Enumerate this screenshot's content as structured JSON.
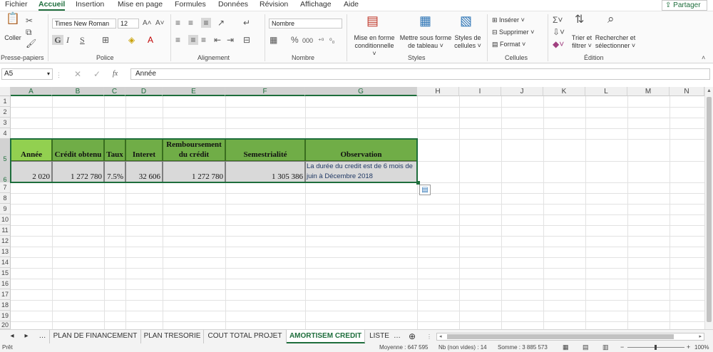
{
  "menu": {
    "items": [
      "Fichier",
      "Accueil",
      "Insertion",
      "Mise en page",
      "Formules",
      "Données",
      "Révision",
      "Affichage",
      "Aide"
    ],
    "share": "Partager"
  },
  "ribbon": {
    "clipboard": {
      "paste": "Coller",
      "label": "Presse-papiers"
    },
    "font": {
      "name": "Times New Roman",
      "size": "12",
      "bold": "G",
      "italic": "I",
      "underline": "S",
      "label": "Police"
    },
    "alignment": {
      "label": "Alignement"
    },
    "number": {
      "format": "Nombre",
      "percent": "%",
      "thousands": "000",
      "label": "Nombre"
    },
    "styles": {
      "conditional": [
        "Mise en forme",
        "conditionnelle"
      ],
      "table": [
        "Mettre sous forme",
        "de tableau"
      ],
      "cell_styles": [
        "Styles de",
        "cellules"
      ],
      "label": "Styles"
    },
    "cells": {
      "insert": "Insérer",
      "delete": "Supprimer",
      "format": "Format",
      "label": "Cellules"
    },
    "editing": {
      "sort": [
        "Trier et",
        "filtrer"
      ],
      "find": [
        "Rechercher et",
        "sélectionner"
      ],
      "label": "Édition"
    }
  },
  "formula_bar": {
    "name_box": "A5",
    "fx": "fx",
    "value": "Année"
  },
  "columns": [
    "A",
    "B",
    "C",
    "D",
    "E",
    "F",
    "G",
    "H",
    "I",
    "J",
    "K",
    "L",
    "M",
    "N"
  ],
  "rows": [
    "1",
    "2",
    "3",
    "4",
    "5",
    "6",
    "7",
    "8",
    "9",
    "10",
    "11",
    "12",
    "13",
    "14",
    "15",
    "16",
    "17",
    "18",
    "19",
    "20"
  ],
  "table": {
    "headers": [
      "Année",
      "Crédit obtenu",
      "Taux",
      "Interet",
      "Remboursement du crédit",
      "Semestrialité",
      "Observation"
    ],
    "values": [
      "2 020",
      "1 272 780",
      "7.5%",
      "32 606",
      "1 272 780",
      "1 305 386"
    ],
    "observation": "La durée du credit est de 6 mois de juin à Décembre 2018"
  },
  "sheets": [
    "PLAN DE FINANCEMENT",
    "PLAN TRESORIE",
    "COUT TOTAL PROJET",
    "AMORTISEM CREDIT",
    "LISTE"
  ],
  "active_sheet_index": 3,
  "status": {
    "mode": "Prêt",
    "average": "Moyenne : 647 595",
    "count": "Nb (non vides) : 14",
    "sum": "Somme : 3 885 573",
    "zoom": "100%"
  },
  "colors": {
    "accent": "#1e6e3c",
    "header_fill": "#70ad47",
    "data_fill": "#d9d9d9"
  }
}
